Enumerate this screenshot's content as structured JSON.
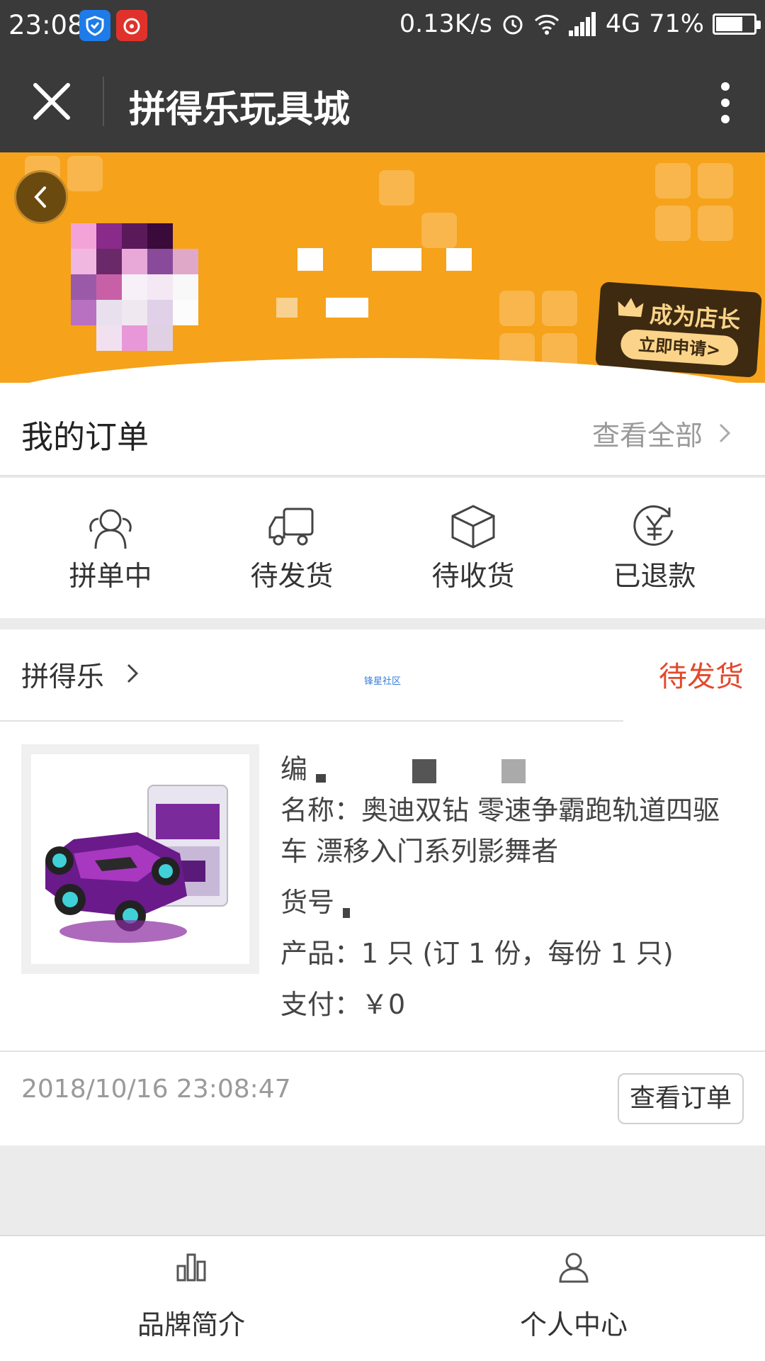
{
  "status_bar": {
    "time": "23:08",
    "network_speed": "0.13K/s",
    "network_type": "4G",
    "battery": "71%",
    "battery_level": 0.71
  },
  "title_bar": {
    "title": "拼得乐玩具城"
  },
  "banner": {
    "apply_title": "成为店长",
    "apply_button": "立即申请>"
  },
  "orders": {
    "header": "我的订单",
    "view_all": "查看全部",
    "statuses": [
      {
        "label": "拼单中",
        "icon": "group-buying-icon"
      },
      {
        "label": "待发货",
        "icon": "delivery-truck-icon"
      },
      {
        "label": "待收货",
        "icon": "package-box-icon"
      },
      {
        "label": "已退款",
        "icon": "refund-yuan-icon"
      }
    ]
  },
  "order_card": {
    "shop_name": "拼得乐",
    "watermark": "锋星社区",
    "status": "待发货",
    "code_label": "编",
    "name_line1": "名称：奥迪双钻 零速争霸跑轨道四驱",
    "name_line2": "车 漂移入门系列影舞者",
    "item_no_label": "货号",
    "product": "产品：1 只 (订 1 份，每份 1 只)",
    "payment": "支付：￥0",
    "time": "2018/10/16 23:08:47",
    "view_order_button": "查看订单"
  },
  "bottom_nav": {
    "items": [
      {
        "label": "品牌简介",
        "icon": "brand-building-icon"
      },
      {
        "label": "个人中心",
        "icon": "user-profile-icon"
      }
    ]
  },
  "colors": {
    "top_bar": "#3a3a3a",
    "banner": "#f6a21a",
    "status_accent": "#e2492b",
    "page_bg": "#ebebeb"
  }
}
